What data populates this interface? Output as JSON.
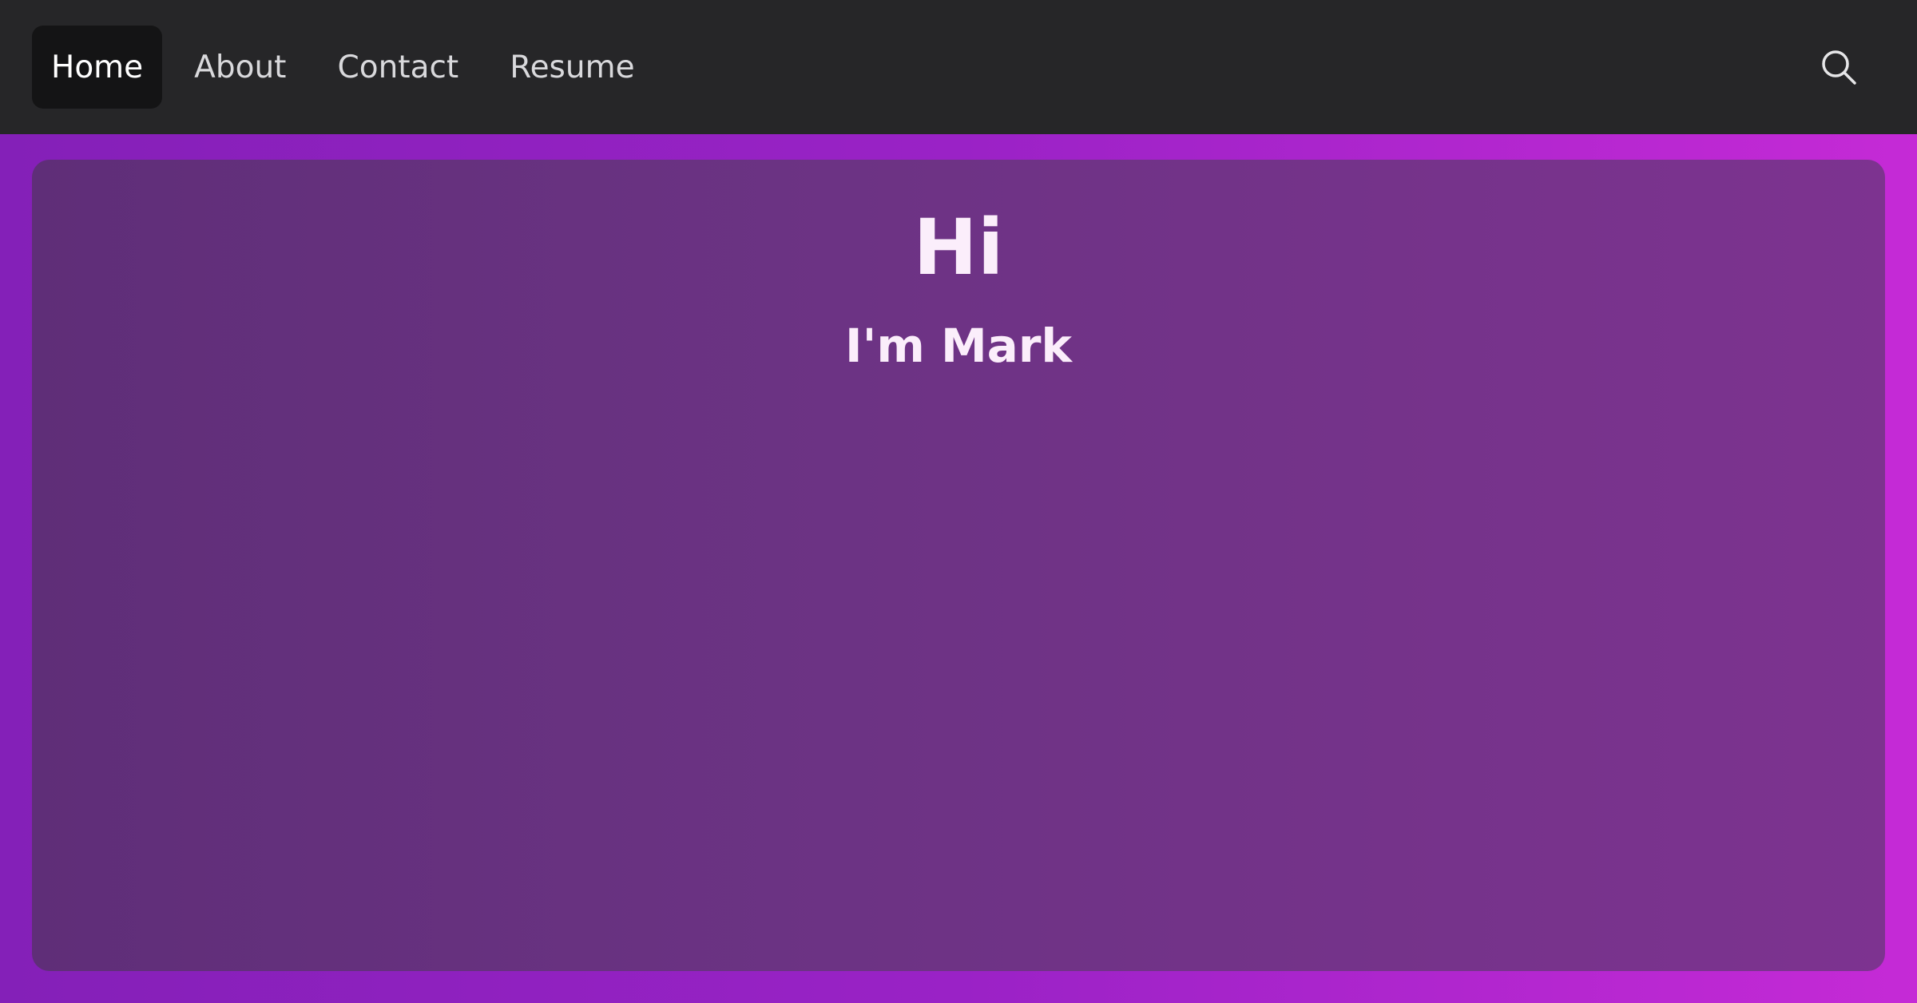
{
  "nav": {
    "items": [
      {
        "label": "Home",
        "active": true
      },
      {
        "label": "About",
        "active": false
      },
      {
        "label": "Contact",
        "active": false
      },
      {
        "label": "Resume",
        "active": false
      }
    ],
    "search_icon": "search-icon"
  },
  "hero": {
    "title": "Hi",
    "subtitle": "I'm Mark"
  },
  "colors": {
    "navbar_bg": "#262628",
    "active_tab_bg": "#141415",
    "background_gradient_start": "#8420b8",
    "background_gradient_end": "#c52ad6",
    "card_bg": "#6b3383",
    "text": "#fbeefb"
  }
}
